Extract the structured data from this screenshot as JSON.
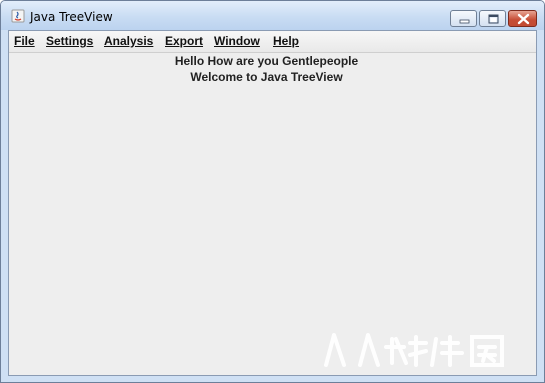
{
  "window": {
    "title": "Java TreeView",
    "controls": {
      "minimize": "minimize-icon",
      "maximize": "maximize-icon",
      "close": "close-icon"
    }
  },
  "menu": {
    "items": [
      {
        "label": "File"
      },
      {
        "label": "Settings"
      },
      {
        "label": "Analysis"
      },
      {
        "label": "Export"
      },
      {
        "label": "Window"
      },
      {
        "label": "Help"
      }
    ]
  },
  "content": {
    "line1": "Hello How are you Gentlepeople",
    "line2": "Welcome to Java TreeView"
  },
  "colors": {
    "titlebar": "#c9dcf3",
    "client_bg": "#eeeeee",
    "close_button": "#c64c34",
    "watermark": "#ffffff"
  }
}
